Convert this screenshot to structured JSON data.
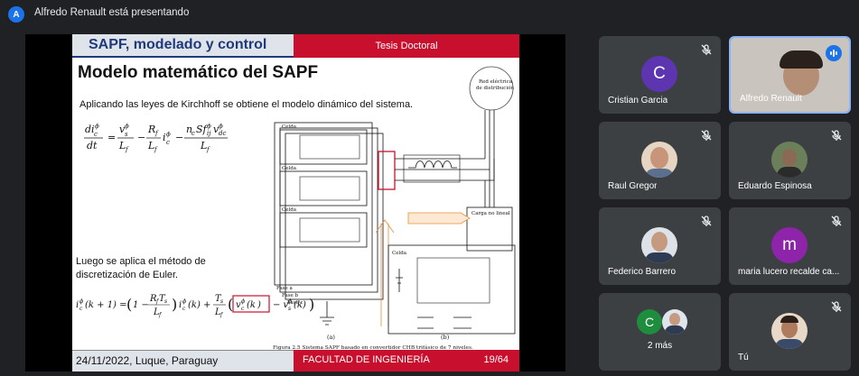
{
  "meeting": {
    "presenter_initial": "A",
    "presenter_banner": "Alfredo Renault está presentando"
  },
  "slide": {
    "header_left": "SAPF, modelado y control",
    "header_right": "Tesis Doctoral",
    "title": "Modelo matemático del SAPF",
    "intro": "Aplicando las leyes de Kirchhoff se obtiene el modelo dinámico del sistema.",
    "luego": "Luego se aplica el método de discretización de Euler.",
    "figure_caption": "Figura 2.5     Sistema SAPF basado en convertidor CHB trifásico de 7 niveles.",
    "fig_labels": {
      "red": "Red eléctrica",
      "red2": "de distribución",
      "carga": "Carga no lineal",
      "fase_a": "Fase a",
      "fase_b": "Fase b",
      "fase_c": "Fase c",
      "celda": "Celda",
      "a": "(a)",
      "b": "(b)"
    },
    "footer_left": "24/11/2022, Luque, Paraguay",
    "footer_center": "FACULTAD DE INGENIERÍA",
    "footer_page": "19/64"
  },
  "participants": [
    {
      "name": "Cristian Garcia",
      "initial": "C",
      "color": "#5e35b1",
      "muted": true
    },
    {
      "name": "Alfredo Renault",
      "speaking": true
    },
    {
      "name": "Raul Gregor",
      "muted": true
    },
    {
      "name": "Eduardo Espinosa",
      "muted": true
    },
    {
      "name": "Federico Barrero",
      "muted": true
    },
    {
      "name": "maria lucero recalde ca...",
      "initial": "m",
      "color": "#8e24aa",
      "muted": true
    },
    {
      "name": "2 más",
      "initial": "C",
      "color": "#1e8e3e"
    },
    {
      "name": "Tú",
      "muted": true
    }
  ]
}
